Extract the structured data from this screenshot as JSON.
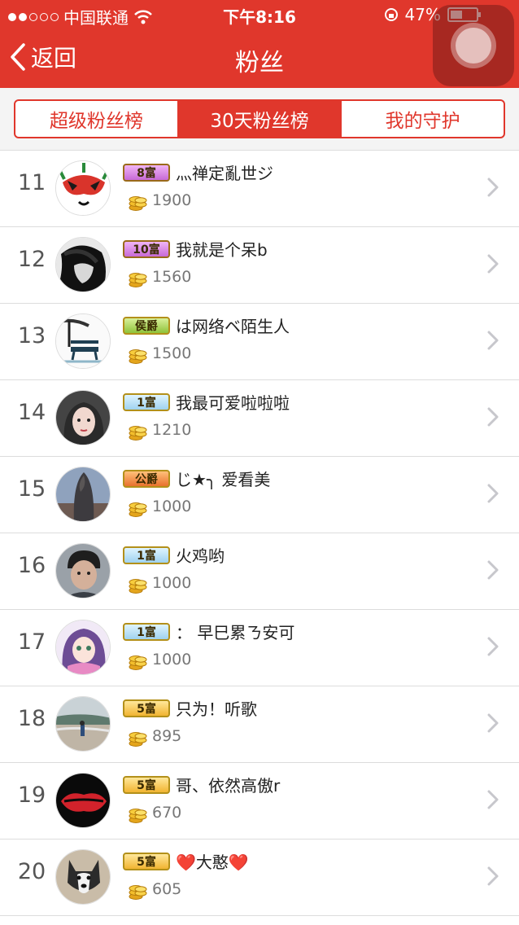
{
  "status": {
    "carrier": "中国联通",
    "time": "下午8:16",
    "battery": "47%",
    "signal_bars": 2,
    "battery_level": 0.47
  },
  "nav": {
    "back_label": "返回",
    "title": "粉丝"
  },
  "tabs": [
    {
      "label": "超级粉丝榜",
      "active": false
    },
    {
      "label": "30天粉丝榜",
      "active": true
    },
    {
      "label": "我的守护",
      "active": false
    }
  ],
  "rows": [
    {
      "rank": "11",
      "badge": "8富",
      "badge_style": "purple",
      "name": "灬禅定亂世ジ",
      "coins": "1900",
      "avatar": "mask"
    },
    {
      "rank": "12",
      "badge": "10富",
      "badge_style": "purple",
      "name": "我就是个呆b",
      "coins": "1560",
      "avatar": "bw-portrait"
    },
    {
      "rank": "13",
      "badge": "侯爵",
      "badge_style": "green",
      "name": "は网络ベ陌生人",
      "coins": "1500",
      "avatar": "bench"
    },
    {
      "rank": "14",
      "badge": "1富",
      "badge_style": "blue",
      "name": "我最可爱啦啦啦",
      "coins": "1210",
      "avatar": "girl"
    },
    {
      "rank": "15",
      "badge": "公爵",
      "badge_style": "orange",
      "name": "じ★╮ 爱看美",
      "coins": "1000",
      "avatar": "cloak"
    },
    {
      "rank": "16",
      "badge": "1富",
      "badge_style": "blue",
      "name": "火鸡哟",
      "coins": "1000",
      "avatar": "boy"
    },
    {
      "rank": "17",
      "badge": "1富",
      "badge_style": "blue",
      "name": "：  早巳累ㄋ安可",
      "coins": "1000",
      "avatar": "anime"
    },
    {
      "rank": "18",
      "badge": "5富",
      "badge_style": "gold",
      "name": "只为！听歌",
      "coins": "895",
      "avatar": "beach"
    },
    {
      "rank": "19",
      "badge": "5富",
      "badge_style": "gold",
      "name": "哥、依然高傲r",
      "coins": "670",
      "avatar": "lips"
    },
    {
      "rank": "20",
      "badge": "5富",
      "badge_style": "gold",
      "name": "❤️大憨❤️",
      "coins": "605",
      "avatar": "dog"
    }
  ],
  "colors": {
    "brand": "#e0372c",
    "divider": "#dcdcdc"
  }
}
